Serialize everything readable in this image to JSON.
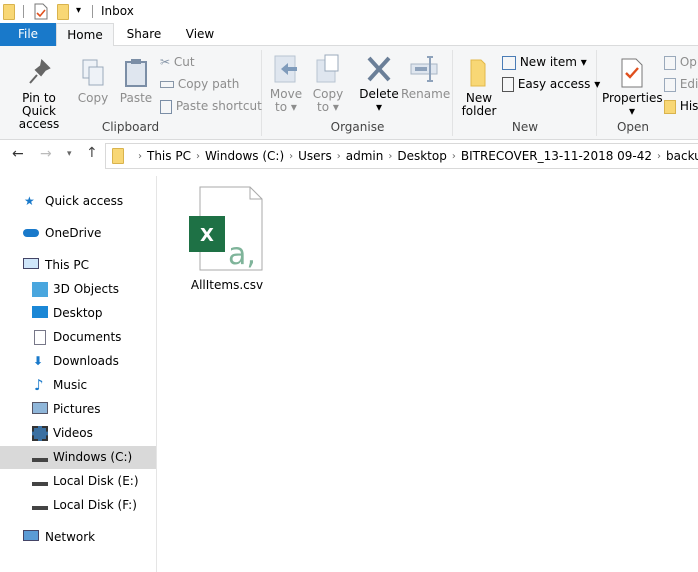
{
  "window": {
    "title": "Inbox"
  },
  "tabs": [
    {
      "label": "File"
    },
    {
      "label": "Home"
    },
    {
      "label": "Share"
    },
    {
      "label": "View"
    }
  ],
  "ribbon": {
    "clipboard": {
      "label": "Clipboard",
      "pin": "Pin to Quick access",
      "pin1": "Pin to Quick",
      "pin2": "access",
      "copy": "Copy",
      "paste": "Paste",
      "cut": "Cut",
      "copy_path": "Copy path",
      "paste_shortcut": "Paste shortcut"
    },
    "organise": {
      "label": "Organise",
      "move1": "Move",
      "move2": "to",
      "copy1": "Copy",
      "copy2": "to",
      "delete": "Delete",
      "rename": "Rename"
    },
    "new": {
      "label": "New",
      "new_folder1": "New",
      "new_folder2": "folder",
      "new_item": "New item",
      "easy_access": "Easy access"
    },
    "open": {
      "label": "Open",
      "properties": "Properties",
      "open": "Op",
      "edit": "Edi",
      "history": "His"
    }
  },
  "address": {
    "crumbs": [
      "This PC",
      "Windows (C:)",
      "Users",
      "admin",
      "Desktop",
      "BITRECOVER_13-11-2018 09-42",
      "backup"
    ]
  },
  "nav": {
    "items": [
      {
        "label": "Quick access",
        "icon": "star-icon"
      },
      {
        "label": "OneDrive",
        "icon": "cloud-icon"
      },
      {
        "label": "This PC",
        "icon": "computer-icon"
      },
      {
        "label": "3D Objects",
        "icon": "cube-icon"
      },
      {
        "label": "Desktop",
        "icon": "desktop-icon"
      },
      {
        "label": "Documents",
        "icon": "document-icon"
      },
      {
        "label": "Downloads",
        "icon": "download-icon"
      },
      {
        "label": "Music",
        "icon": "music-icon"
      },
      {
        "label": "Pictures",
        "icon": "picture-icon"
      },
      {
        "label": "Videos",
        "icon": "video-icon"
      },
      {
        "label": "Windows (C:)",
        "icon": "drive-icon",
        "selected": true
      },
      {
        "label": "Local Disk (E:)",
        "icon": "drive-icon"
      },
      {
        "label": "Local Disk (F:)",
        "icon": "drive-icon"
      },
      {
        "label": "Network",
        "icon": "network-icon"
      }
    ]
  },
  "files": [
    {
      "name": "AllItems.csv",
      "icon": "excel-csv-icon"
    }
  ],
  "colors": {
    "accent": "#1979ca",
    "excel": "#1e7145"
  }
}
